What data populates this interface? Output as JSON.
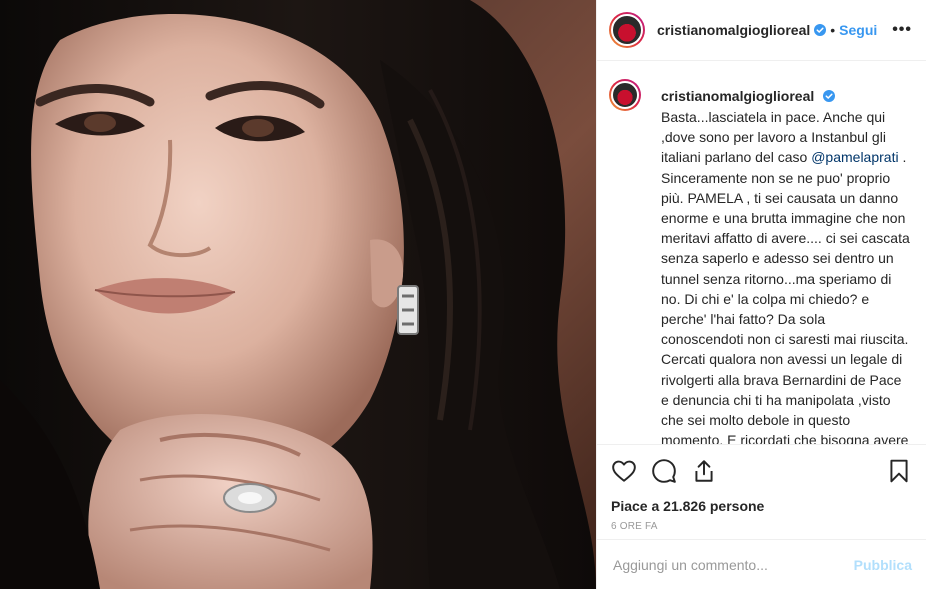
{
  "post": {
    "username": "cristianomalgioglioreal",
    "follow_label": "Segui",
    "more_label": "•••",
    "dot": "•",
    "caption_text": "Basta...lasciatela in pace. Anche qui ,dove sono per lavoro a Instanbul gli italiani parlano del caso ",
    "mention": "@pamelaprati",
    "caption_rest": " . Sinceramente non se ne puo' proprio più. PAMELA , ti sei causata un danno enorme e una brutta immagine che non meritavi affatto di avere.... ci sei cascata senza saperlo e adesso sei dentro un tunnel senza ritorno...ma speriamo di no. Di chi e' la colpa mi chiedo? e perche' l'hai fatto? Da sola conoscendoti non ci saresti mai riuscita. Cercati qualora non avessi un legale di rivolgerti alla brava Bernardini de Pace e denuncia chi ti ha manipolata ,visto che sei molto debole in questo momento. E ricordati che bisogna avere rispetto con il pubblico che segue incredulo la vicenda. Chiedi",
    "likes_prefix": "Piace a ",
    "likes_count": "21.826",
    "likes_suffix": " persone",
    "time_ago": "6 ORE FA",
    "comment_placeholder": "Aggiungi un commento...",
    "publish_label": "Pubblica"
  },
  "icons": {
    "like": "heart-icon",
    "comment": "comment-icon",
    "share": "share-icon",
    "save": "bookmark-icon",
    "verified": "verified-badge-icon"
  },
  "colors": {
    "link": "#3897f0",
    "mention": "#003569",
    "publish_disabled": "#b2dffc",
    "verified": "#3897f0"
  }
}
